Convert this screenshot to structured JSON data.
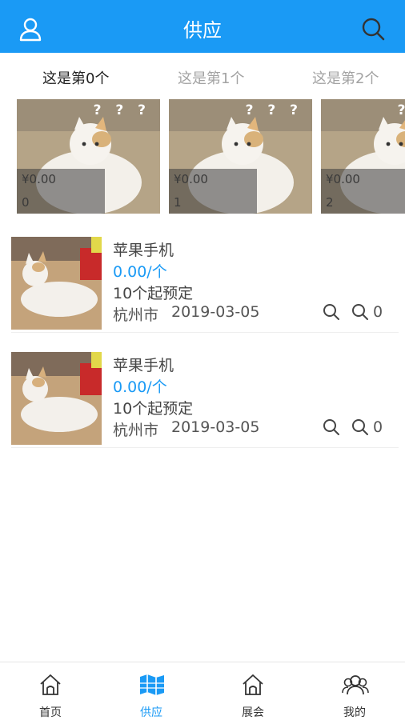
{
  "header": {
    "title": "供应",
    "left_icon": "user-icon",
    "right_icon": "search-icon"
  },
  "tabs": [
    {
      "label": "这是第0个",
      "active": true
    },
    {
      "label": "这是第1个",
      "active": false
    },
    {
      "label": "这是第2个",
      "active": false
    }
  ],
  "carousel": [
    {
      "price": "¥0.00",
      "index": "0"
    },
    {
      "price": "¥0.00",
      "index": "1"
    },
    {
      "price": "¥0.00",
      "index": "2"
    }
  ],
  "card_marks": "? ? ?",
  "list": [
    {
      "title": "苹果手机",
      "price": "0.00/个",
      "moq": "10个起预定",
      "city": "杭州市",
      "date": "2019-03-05",
      "count": "0"
    },
    {
      "title": "苹果手机",
      "price": "0.00/个",
      "moq": "10个起预定",
      "city": "杭州市",
      "date": "2019-03-05",
      "count": "0"
    }
  ],
  "bottom_nav": [
    {
      "label": "首页",
      "icon": "home-icon",
      "active": false
    },
    {
      "label": "供应",
      "icon": "map-icon",
      "active": true
    },
    {
      "label": "展会",
      "icon": "home-icon",
      "active": false
    },
    {
      "label": "我的",
      "icon": "people-icon",
      "active": false
    }
  ],
  "colors": {
    "accent": "#1a9af5",
    "price": "#1a9af5"
  }
}
